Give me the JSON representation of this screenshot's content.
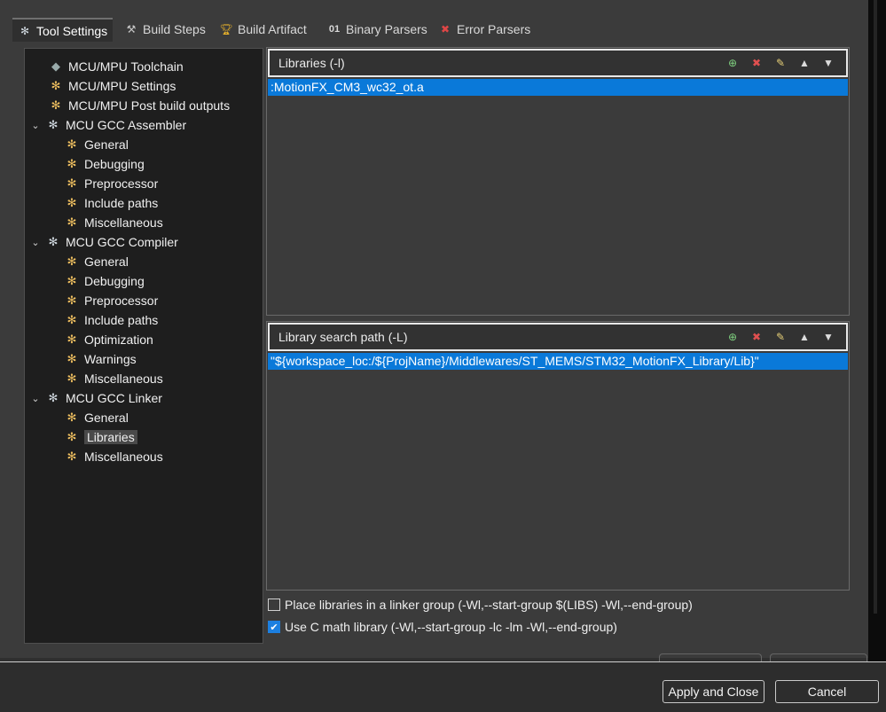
{
  "tabs": [
    {
      "label": "Tool Settings",
      "icon": "gear-icon"
    },
    {
      "label": "Build Steps",
      "icon": "hammer-icon"
    },
    {
      "label": "Build Artifact",
      "icon": "trophy-icon"
    },
    {
      "label": "Binary Parsers",
      "icon": "binary-icon"
    },
    {
      "label": "Error Parsers",
      "icon": "error-icon"
    }
  ],
  "tree": {
    "toolchain": "MCU/MPU Toolchain",
    "settings": "MCU/MPU Settings",
    "post_build": "MCU/MPU Post build outputs",
    "assembler": {
      "label": "MCU GCC Assembler",
      "children": [
        "General",
        "Debugging",
        "Preprocessor",
        "Include paths",
        "Miscellaneous"
      ]
    },
    "compiler": {
      "label": "MCU GCC Compiler",
      "children": [
        "General",
        "Debugging",
        "Preprocessor",
        "Include paths",
        "Optimization",
        "Warnings",
        "Miscellaneous"
      ]
    },
    "linker": {
      "label": "MCU GCC Linker",
      "children": [
        "General",
        "Libraries",
        "Miscellaneous"
      ]
    },
    "selected": "Libraries"
  },
  "libraries_panel": {
    "title": "Libraries (-l)",
    "items": [
      ":MotionFX_CM3_wc32_ot.a"
    ]
  },
  "search_panel": {
    "title": "Library search path (-L)",
    "items": [
      "\"${workspace_loc:/${ProjName}/Middlewares/ST_MEMS/STM32_MotionFX_Library/Lib}\""
    ]
  },
  "panel_actions": [
    "add-icon",
    "delete-icon",
    "edit-icon",
    "move-up-icon",
    "move-down-icon"
  ],
  "options": {
    "linker_group": {
      "label": "Place libraries in a linker group (-Wl,--start-group $(LIBS) -Wl,--end-group)",
      "checked": false
    },
    "math_lib": {
      "label": "Use C math library (-Wl,--start-group -lc -lm -Wl,--end-group)",
      "checked": true
    }
  },
  "buttons": {
    "apply_close": "Apply and Close",
    "cancel": "Cancel"
  },
  "colors": {
    "selection": "#0a79d9",
    "background": "#3b3b3b",
    "tree_bg": "#1e1e1e"
  }
}
